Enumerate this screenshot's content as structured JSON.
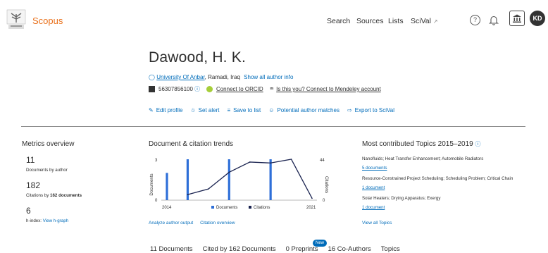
{
  "header": {
    "brand": "Scopus",
    "nav": [
      "Search",
      "Sources",
      "Lists",
      "SciVal"
    ],
    "scival_caret": "↗",
    "help_glyph": "?",
    "avatar_initials": "KD",
    "colors": {
      "brand": "#e9711c",
      "link": "#006cba"
    }
  },
  "author": {
    "name": "Dawood, H. K.",
    "affiliation": "University Of Anbar",
    "location": ", Ramadi, Iraq",
    "show_all_info": "Show all author info",
    "scopus_id": "56307856100",
    "connect_orcid": "Connect to ORCID",
    "mendeley": "Is this you? Connect to Mendeley account"
  },
  "actions": [
    "Edit profile",
    "Set alert",
    "Save to list",
    "Potential author matches",
    "Export to SciVal"
  ],
  "metrics": {
    "title": "Metrics overview",
    "documents_value": "11",
    "documents_label": "Documents by author",
    "citations_value": "182",
    "citations_label_pre": "Citations by ",
    "citations_label_bold": "162 documents",
    "hindex_value": "6",
    "hindex_label": "h-index: ",
    "hindex_link": "View h-graph"
  },
  "trends": {
    "title": "Document & citation trends",
    "y_left_label": "Documents",
    "y_right_label": "Citations",
    "y_left_ticks": [
      "3",
      "0"
    ],
    "y_right_ticks": [
      "44",
      "0"
    ],
    "x_start": "2014",
    "x_end": "2021",
    "legend_docs": "Documents",
    "legend_cites": "Citations",
    "link_analyze": "Analyze author output",
    "link_citation": "Citation overview"
  },
  "chart_data": {
    "type": "bar",
    "x": [
      2014,
      2015,
      2016,
      2017,
      2018,
      2019,
      2020,
      2021
    ],
    "series": [
      {
        "name": "Documents",
        "type": "bar",
        "values": [
          2,
          3,
          0,
          3,
          0,
          3,
          0,
          0
        ],
        "color": "#2e6fd8",
        "axis": "left"
      },
      {
        "name": "Citations",
        "type": "line",
        "values": [
          null,
          6,
          12,
          30,
          41,
          40,
          44,
          2
        ],
        "color": "#1a2350",
        "axis": "right"
      }
    ],
    "ylim_left": [
      0,
      3
    ],
    "ylim_right": [
      0,
      44
    ]
  },
  "topics": {
    "title": "Most contributed Topics 2015–2019",
    "items": [
      {
        "name": "Nanofluids; Heat Transfer Enhancement; Automobile Radiators",
        "docs": "5 documents"
      },
      {
        "name": "Resource-Constrained Project Scheduling; Scheduling Problem; Critical Chain",
        "docs": "1 document"
      },
      {
        "name": "Solar Heaters; Drying Apparatus; Exergy",
        "docs": "1 document"
      }
    ],
    "view_all": "View all Topics"
  },
  "tabs": [
    "11 Documents",
    "Cited by 162 Documents",
    "0 Preprints",
    "16 Co-Authors",
    "Topics"
  ],
  "new_badge": "New"
}
